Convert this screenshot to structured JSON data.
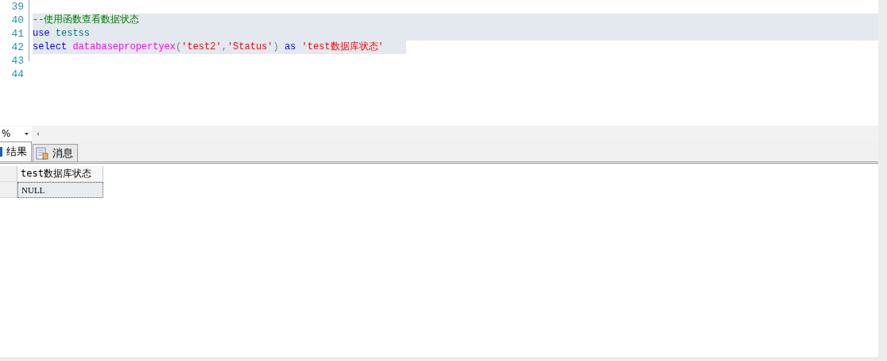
{
  "editor": {
    "lines": [
      {
        "number": "39",
        "selected": false
      },
      {
        "number": "40",
        "selected": true,
        "tokens": [
          {
            "kind": "comment",
            "text": "--使用函数查看数据状态"
          }
        ]
      },
      {
        "number": "41",
        "selected": true,
        "tokens": [
          {
            "kind": "keyword",
            "text": "use"
          },
          {
            "kind": "identifier",
            "text": " testss"
          }
        ]
      },
      {
        "number": "42",
        "selected": true,
        "tokens": [
          {
            "kind": "keyword",
            "text": "select"
          },
          {
            "kind": "function",
            "text": " databasepropertyex"
          },
          {
            "kind": "punct",
            "text": "("
          },
          {
            "kind": "string",
            "text": "'test2'"
          },
          {
            "kind": "punct",
            "text": ","
          },
          {
            "kind": "string",
            "text": "'Status'"
          },
          {
            "kind": "punct",
            "text": ")"
          },
          {
            "kind": "keyword",
            "text": " as"
          },
          {
            "kind": "string",
            "text": " 'test数据库状态'"
          }
        ]
      },
      {
        "number": "43",
        "selected": false
      },
      {
        "number": "44",
        "selected": false
      }
    ]
  },
  "zoom": {
    "value": "%"
  },
  "tabs": [
    {
      "label": "结果",
      "selected": true,
      "kind": "grid"
    },
    {
      "label": "消息",
      "selected": false,
      "kind": "messages"
    }
  ],
  "grid": {
    "columns": [
      "test数据库状态"
    ],
    "rows": [
      {
        "cells": [
          "NULL"
        ],
        "selected": true
      }
    ]
  }
}
